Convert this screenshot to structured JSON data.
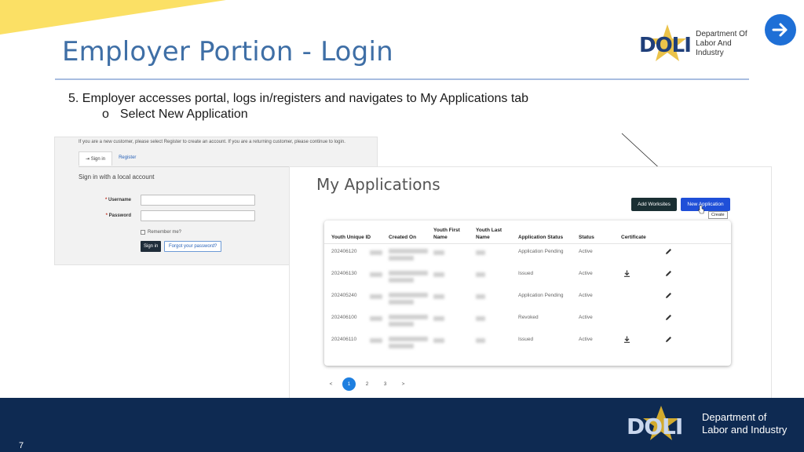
{
  "slide": {
    "title": "Employer Portion - Login",
    "bullet_main": "5. Employer accesses portal, logs in/registers and navigates to My Applications tab",
    "bullet_sub_marker": "o",
    "bullet_sub": "Select New Application",
    "page_number": "7",
    "colors": {
      "title": "#3f6fa6",
      "accent_yellow": "#fbe065",
      "footer": "#0e2a52",
      "next_button": "#1e6fd6"
    }
  },
  "logo_top": {
    "mark_text": "DOLI",
    "line1": "Department Of",
    "line2": "Labor And Industry"
  },
  "logo_bottom": {
    "mark_text": "DOLI",
    "line1": "Department of",
    "line2": "Labor and Industry"
  },
  "login": {
    "notice": "If you are a new customer, please select Register to create an account. If you are a returning customer, please continue to login.",
    "tab_signin": "Sign in",
    "tab_register": "Register",
    "heading": "Sign in with a local account",
    "username_label": "Username",
    "password_label": "Password",
    "required_marker": "*",
    "remember_label": "Remember me?",
    "signin_button": "Sign in",
    "forgot_button": "Forgot your password?"
  },
  "applications": {
    "title": "My Applications",
    "add_worksites_button": "Add Worksites",
    "new_application_button": "New Application",
    "tooltip": "Create",
    "columns": {
      "youth_id": "Youth Unique ID",
      "created_on": "Created On",
      "first_name_l1": "Youth First",
      "first_name_l2": "Name",
      "last_name_l1": "Youth Last",
      "last_name_l2": "Name",
      "app_status": "Application Status",
      "status": "Status",
      "certificate": "Certificate"
    },
    "rows": [
      {
        "id": "202406120",
        "app_status": "Application Pending",
        "status": "Active",
        "has_download": false
      },
      {
        "id": "202406130",
        "app_status": "Issued",
        "status": "Active",
        "has_download": true
      },
      {
        "id": "202405240",
        "app_status": "Application Pending",
        "status": "Active",
        "has_download": false
      },
      {
        "id": "202406100",
        "app_status": "Revoked",
        "status": "Active",
        "has_download": false
      },
      {
        "id": "202406110",
        "app_status": "Issued",
        "status": "Active",
        "has_download": true
      }
    ],
    "pager": {
      "prev": "<",
      "pages": [
        "1",
        "2",
        "3"
      ],
      "next": ">",
      "active_page": "1"
    }
  }
}
